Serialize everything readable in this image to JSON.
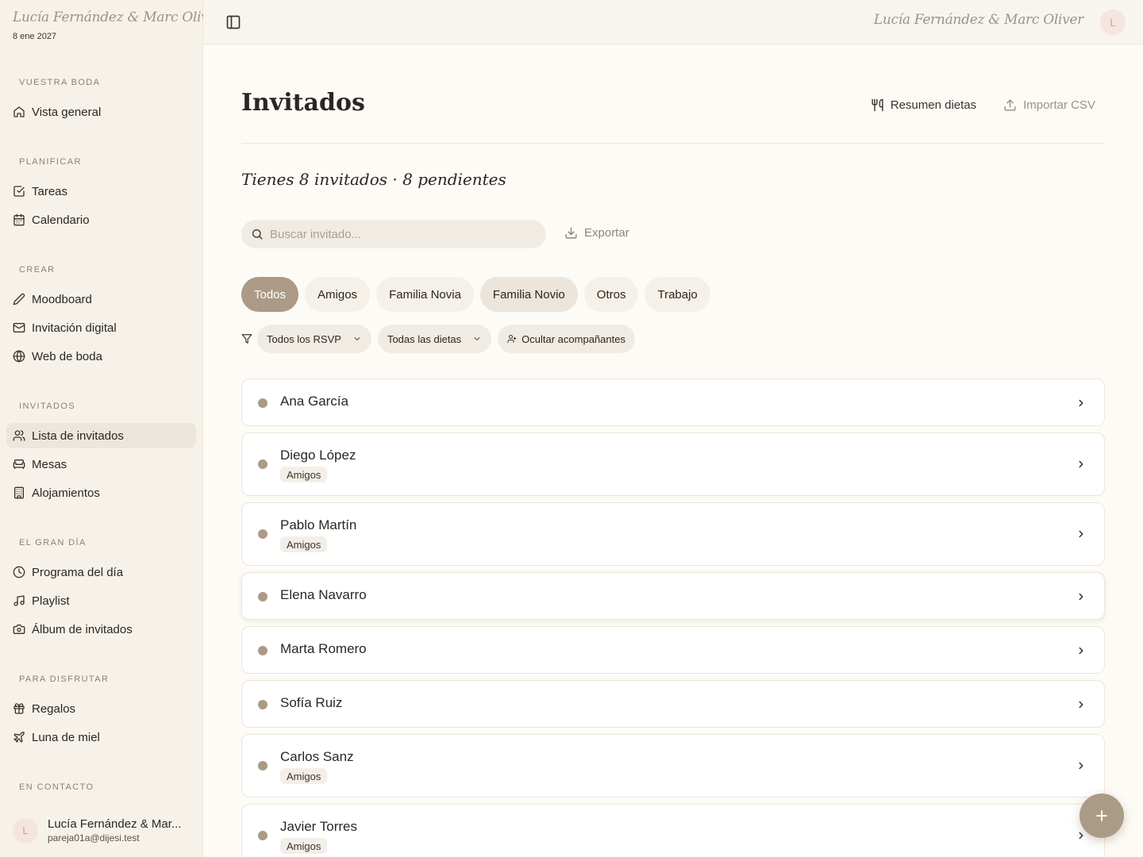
{
  "colors": {
    "accent": "#ab9b86",
    "sidebar_bg": "#f6f2ea",
    "page_bg": "#fdfbf6",
    "avatar_bg": "#f6e4e0"
  },
  "brand": {
    "couple_script": "Lucía Fernández & Marc Oliver",
    "date": "8 ene 2027"
  },
  "sidebar": {
    "sections": [
      {
        "title": "VUESTRA BODA",
        "items": [
          {
            "label": "Vista general",
            "icon": "home-icon"
          }
        ]
      },
      {
        "title": "PLANIFICAR",
        "items": [
          {
            "label": "Tareas",
            "icon": "checkbox-icon"
          },
          {
            "label": "Calendario",
            "icon": "calendar-icon"
          }
        ]
      },
      {
        "title": "CREAR",
        "items": [
          {
            "label": "Moodboard",
            "icon": "pencil-icon"
          },
          {
            "label": "Invitación digital",
            "icon": "mail-icon"
          },
          {
            "label": "Web de boda",
            "icon": "globe-icon"
          }
        ]
      },
      {
        "title": "INVITADOS",
        "items": [
          {
            "label": "Lista de invitados",
            "icon": "users-icon",
            "active": true
          },
          {
            "label": "Mesas",
            "icon": "sofa-icon"
          },
          {
            "label": "Alojamientos",
            "icon": "building-icon"
          }
        ]
      },
      {
        "title": "EL GRAN DÍA",
        "items": [
          {
            "label": "Programa del día",
            "icon": "clock-icon"
          },
          {
            "label": "Playlist",
            "icon": "music-icon"
          },
          {
            "label": "Álbum de invitados",
            "icon": "camera-icon"
          }
        ]
      },
      {
        "title": "PARA DISFRUTAR",
        "items": [
          {
            "label": "Regalos",
            "icon": "gift-icon"
          },
          {
            "label": "Luna de miel",
            "icon": "plane-icon"
          }
        ]
      },
      {
        "title": "EN CONTACTO",
        "items": []
      }
    ]
  },
  "user": {
    "initial": "L",
    "name": "Lucía Fernández & Mar...",
    "email": "pareja01a@dijesi.test"
  },
  "topbar": {
    "couple_script": "Lucía Fernández & Marc Oliver",
    "avatar_initial": "L"
  },
  "page": {
    "title": "Invitados",
    "actions": {
      "diets": "Resumen dietas",
      "import": "Importar CSV"
    },
    "summary": "Tienes 8 invitados · 8 pendientes",
    "search_placeholder": "Buscar invitado...",
    "export": "Exportar"
  },
  "tabs": [
    {
      "label": "Todos",
      "active": true
    },
    {
      "label": "Amigos"
    },
    {
      "label": "Familia Novia"
    },
    {
      "label": "Familia Novio",
      "hover": true
    },
    {
      "label": "Otros"
    },
    {
      "label": "Trabajo"
    }
  ],
  "filters": {
    "rsvp": "Todos los RSVP",
    "diets": "Todas las dietas",
    "companions": "Ocultar acompañantes"
  },
  "guests": [
    {
      "name": "Ana García",
      "tag": ""
    },
    {
      "name": "Diego López",
      "tag": "Amigos"
    },
    {
      "name": "Pablo Martín",
      "tag": "Amigos"
    },
    {
      "name": "Elena Navarro",
      "tag": ""
    },
    {
      "name": "Marta Romero",
      "tag": ""
    },
    {
      "name": "Sofía Ruiz",
      "tag": ""
    },
    {
      "name": "Carlos Sanz",
      "tag": "Amigos"
    },
    {
      "name": "Javier Torres",
      "tag": "Amigos"
    }
  ]
}
